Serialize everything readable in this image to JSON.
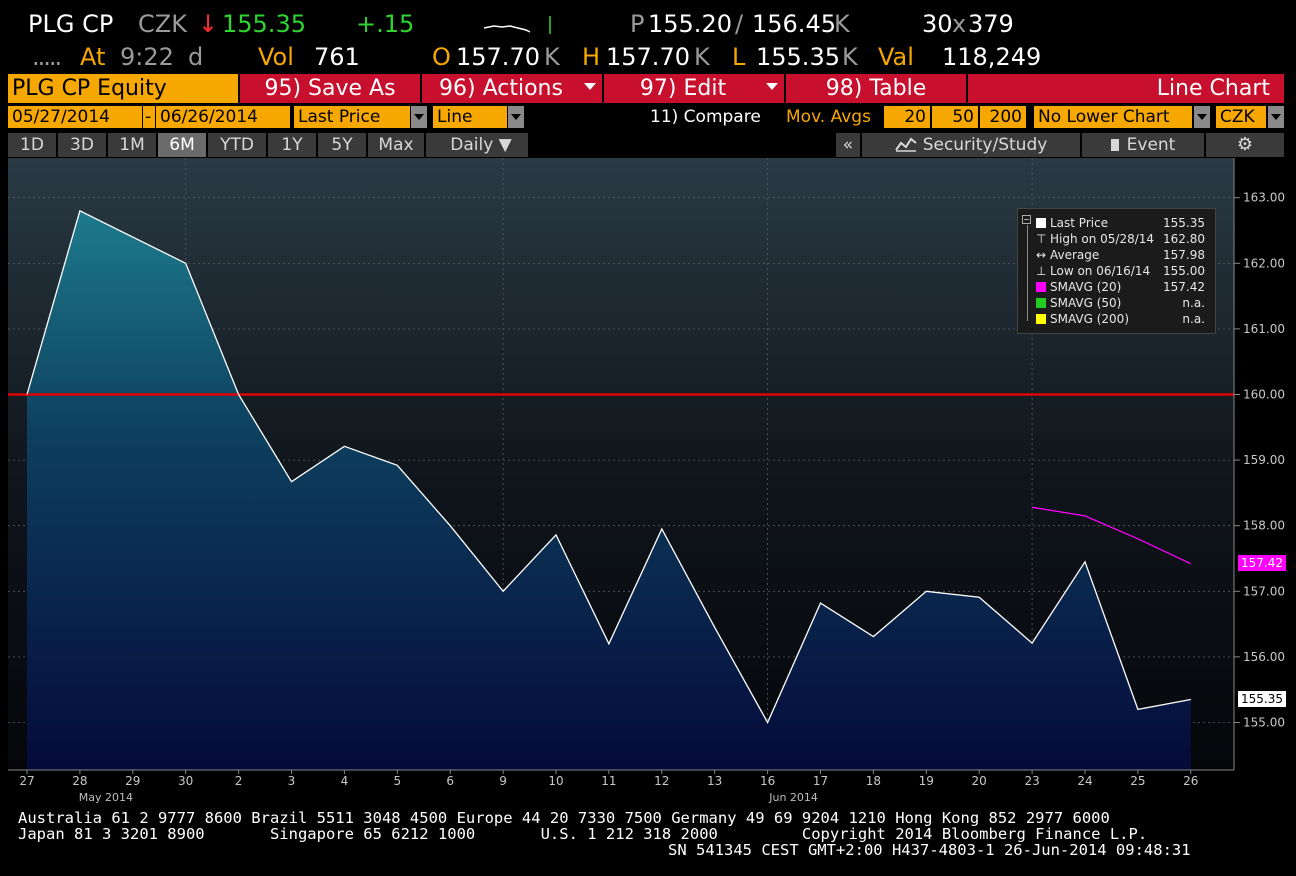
{
  "header": {
    "ticker": "PLG CP",
    "currency": "CZK",
    "change_arrow": "↓",
    "last_price": "155.35",
    "net_change": "+.15",
    "bid_ask_prefix": "P",
    "bid": "155.20",
    "slash": "/",
    "ask": "156.45",
    "bid_suffix": "K",
    "ask_suffix": "K",
    "size": "30",
    "size_x": "x",
    "size2": "379",
    "dots": ".....",
    "at_label": "At",
    "time": "9:22",
    "time_suffix": "d",
    "vol_label": "Vol",
    "volume": "761",
    "open_label": "O",
    "open": "157.70",
    "open_suffix": "K",
    "high_label": "H",
    "high": "157.70",
    "high_suffix": "K",
    "low_label": "L",
    "low": "155.35",
    "low_suffix": "K",
    "val_label": "Val",
    "value": "118,249"
  },
  "function_bar": {
    "security": "PLG CP Equity",
    "save_as": "95) Save As",
    "actions": "96) Actions",
    "edit": "97) Edit",
    "table": "98) Table",
    "view": "Line Chart"
  },
  "options": {
    "start_date": "05/27/2014",
    "dash": "-",
    "end_date": "06/26/2014",
    "price_field": "Last Price",
    "chart_style": "Line",
    "compare": "11) Compare",
    "mov_avgs_label": "Mov. Avgs",
    "ma1": "20",
    "ma2": "50",
    "ma3": "200",
    "lower_chart": "No Lower Chart",
    "currency": "CZK"
  },
  "periods": [
    "1D",
    "3D",
    "1M",
    "6M",
    "YTD",
    "1Y",
    "5Y",
    "Max"
  ],
  "active_period": "6M",
  "frequency": "Daily ▼",
  "toolbar": {
    "collapse": "«",
    "security_study": "Security/Study",
    "event": "Event",
    "settings_icon": "gear-icon"
  },
  "legend": {
    "rows": [
      {
        "label": "Last Price",
        "value": "155.35",
        "marker": "white-square"
      },
      {
        "label": "High on 05/28/14",
        "value": "162.80",
        "marker": "high-icon"
      },
      {
        "label": "Average",
        "value": "157.98",
        "marker": "average-icon"
      },
      {
        "label": "Low on 06/16/14",
        "value": "155.00",
        "marker": "low-icon"
      },
      {
        "label": "SMAVG (20)",
        "value": "157.42",
        "marker": "#ff00ff"
      },
      {
        "label": "SMAVG (50)",
        "value": "n.a.",
        "marker": "#22cc22"
      },
      {
        "label": "SMAVG (200)",
        "value": "n.a.",
        "marker": "#ffff00"
      }
    ]
  },
  "price_tags": {
    "sma20": "157.42",
    "last": "155.35"
  },
  "chart_data": {
    "type": "area",
    "x": [
      "27",
      "28",
      "29",
      "30",
      "2",
      "3",
      "4",
      "5",
      "6",
      "9",
      "10",
      "11",
      "12",
      "13",
      "16",
      "17",
      "18",
      "19",
      "20",
      "23",
      "24",
      "25",
      "26"
    ],
    "x_sublabels": [
      {
        "at": "28",
        "text": "May 2014"
      },
      {
        "at": "16",
        "text": "Jun 2014"
      }
    ],
    "series": [
      {
        "name": "Last Price",
        "color": "#ffffff",
        "values": [
          160.0,
          162.8,
          162.4,
          162.0,
          160.0,
          158.67,
          159.21,
          158.92,
          158.0,
          157.0,
          157.86,
          156.2,
          157.95,
          156.45,
          155.0,
          156.82,
          156.31,
          157.0,
          156.91,
          156.21,
          157.45,
          155.2,
          155.35
        ]
      },
      {
        "name": "SMAVG (20)",
        "color": "#ff00ff",
        "values": [
          null,
          null,
          null,
          null,
          null,
          null,
          null,
          null,
          null,
          null,
          null,
          null,
          null,
          null,
          null,
          null,
          null,
          null,
          null,
          158.28,
          158.15,
          157.8,
          157.42
        ]
      }
    ],
    "hline": {
      "value": 160.0,
      "color": "#e00000"
    },
    "y_ticks": [
      "155.00",
      "156.00",
      "157.00",
      "158.00",
      "159.00",
      "160.00",
      "161.00",
      "162.00",
      "163.00"
    ],
    "ylim": [
      154.1,
      163.5
    ],
    "grid": true,
    "legend_position": "top-right"
  },
  "footer": {
    "line1": "Australia 61 2 9777 8600 Brazil 5511 3048 4500 Europe 44 20 7330 7500 Germany 49 69 9204 1210 Hong Kong 852 2977 6000",
    "line2": "Japan 81 3 3201 8900       Singapore 65 6212 1000       U.S. 1 212 318 2000         Copyright 2014 Bloomberg Finance L.P.",
    "line3": "SN 541345 CEST GMT+2:00 H437-4803-1 26-Jun-2014 09:48:31"
  },
  "colors": {
    "amber": "#f7a800",
    "red_button": "#c8102e",
    "up_green": "#2fd52f",
    "down_red": "#ff2a2a"
  }
}
